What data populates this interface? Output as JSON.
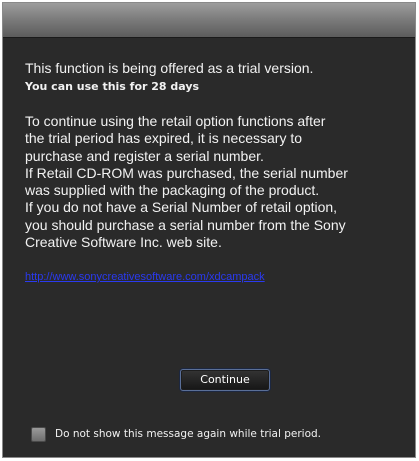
{
  "dialog": {
    "lead_text": "This function is being offered as a trial version.",
    "trial_days_text": "You can use this for 28 days",
    "body_lines": [
      "To continue using the retail option functions after",
      "the trial period has expired, it is necessary to",
      "purchase and register a serial number.",
      "If Retail CD-ROM was purchased, the serial number",
      "was supplied with the packaging of the product.",
      "If you do not have a Serial Number of retail option,",
      "you should purchase a serial number from the Sony",
      "Creative Software Inc. web site."
    ],
    "link_text": "http://www.sonycreativesoftware.com/xdcampack",
    "continue_label": "Continue",
    "dont_show_label": "Do not show this message again while trial period.",
    "dont_show_checked": false
  },
  "colors": {
    "background": "#2a2a2a",
    "text": "#f2f2f2",
    "link": "#2a3af0",
    "button_border": "#5a6f98"
  }
}
